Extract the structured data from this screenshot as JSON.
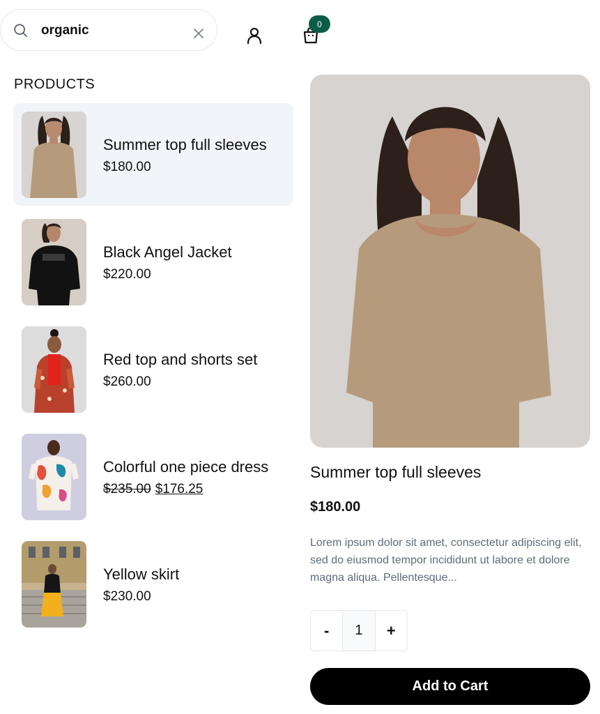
{
  "header": {
    "search_value": "organic",
    "cart_count": "0"
  },
  "products": {
    "section_title": "PRODUCTS",
    "items": [
      {
        "name": "Summer top full sleeves",
        "price": "$180.00"
      },
      {
        "name": "Black Angel Jacket",
        "price": "$220.00"
      },
      {
        "name": "Red top and shorts set",
        "price": "$260.00"
      },
      {
        "name": "Colorful one piece dress",
        "old_price": "$235.00",
        "sale_price": "$176.25"
      },
      {
        "name": "Yellow skirt",
        "price": "$230.00"
      }
    ]
  },
  "detail": {
    "title": "Summer top full sleeves",
    "price": "$180.00",
    "description": "Lorem ipsum dolor sit amet, consectetur adipiscing elit, sed do eiusmod tempor incididunt ut labore et dolore magna aliqua. Pellentesque...",
    "quantity": "1",
    "minus_label": "-",
    "plus_label": "+",
    "add_to_cart_label": "Add to Cart"
  },
  "colors": {
    "accent": "#0d5c4a",
    "active_row": "#f1f4f8",
    "button": "#000000",
    "muted_text": "#5f6b7b"
  }
}
